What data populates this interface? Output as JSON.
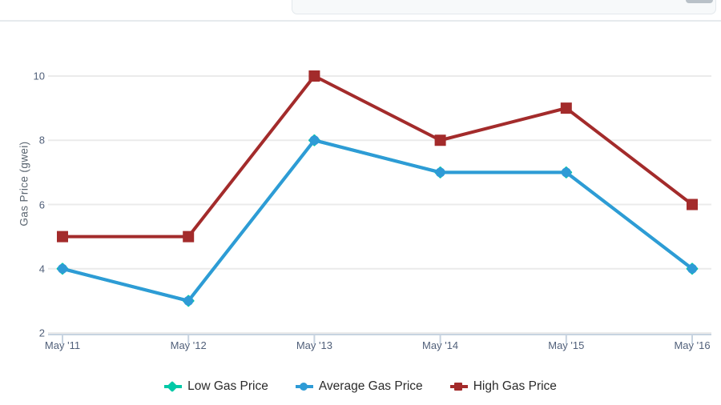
{
  "top_bar": {
    "panel_name": "toolbar-panel",
    "button_name": "toolbar-button"
  },
  "chart_data": {
    "type": "line",
    "title": "",
    "xlabel": "",
    "ylabel": "Gas Price (gwei)",
    "categories": [
      "May '11",
      "May '12",
      "May '13",
      "May '14",
      "May '15",
      "May '16"
    ],
    "ylim": [
      2,
      10
    ],
    "yticks": [
      2,
      4,
      6,
      8,
      10
    ],
    "grid": true,
    "legend_position": "bottom",
    "series": [
      {
        "name": "Low Gas Price",
        "color": "#00c9a7",
        "marker": "diamond",
        "values": [
          4,
          3,
          8,
          7,
          7,
          4
        ]
      },
      {
        "name": "Average Gas Price",
        "color": "#2e9bd6",
        "marker": "plus",
        "values": [
          4,
          3,
          8,
          7,
          7,
          4
        ]
      },
      {
        "name": "High Gas Price",
        "color": "#a32b2b",
        "marker": "square",
        "values": [
          5,
          5,
          10,
          8,
          9,
          6
        ]
      }
    ]
  },
  "axis": {
    "y_tick_labels": [
      "10",
      "8",
      "6",
      "4",
      "2"
    ],
    "x_tick_labels": [
      "May '11",
      "May '12",
      "May '13",
      "May '14",
      "May '15",
      "May '16"
    ],
    "y_title": "Gas Price (gwei)"
  },
  "legend": {
    "items": [
      {
        "label": "Low Gas Price",
        "color": "#00c9a7",
        "marker": "diamond"
      },
      {
        "label": "Average Gas Price",
        "color": "#2e9bd6",
        "marker": "plus"
      },
      {
        "label": "High Gas Price",
        "color": "#a32b2b",
        "marker": "square"
      }
    ]
  },
  "colors": {
    "grid": "#ebebeb",
    "axis": "#c7d3e0",
    "tick_text": "#51607a",
    "divider": "#e6eaed",
    "panel_bg": "#f7f9fa"
  }
}
